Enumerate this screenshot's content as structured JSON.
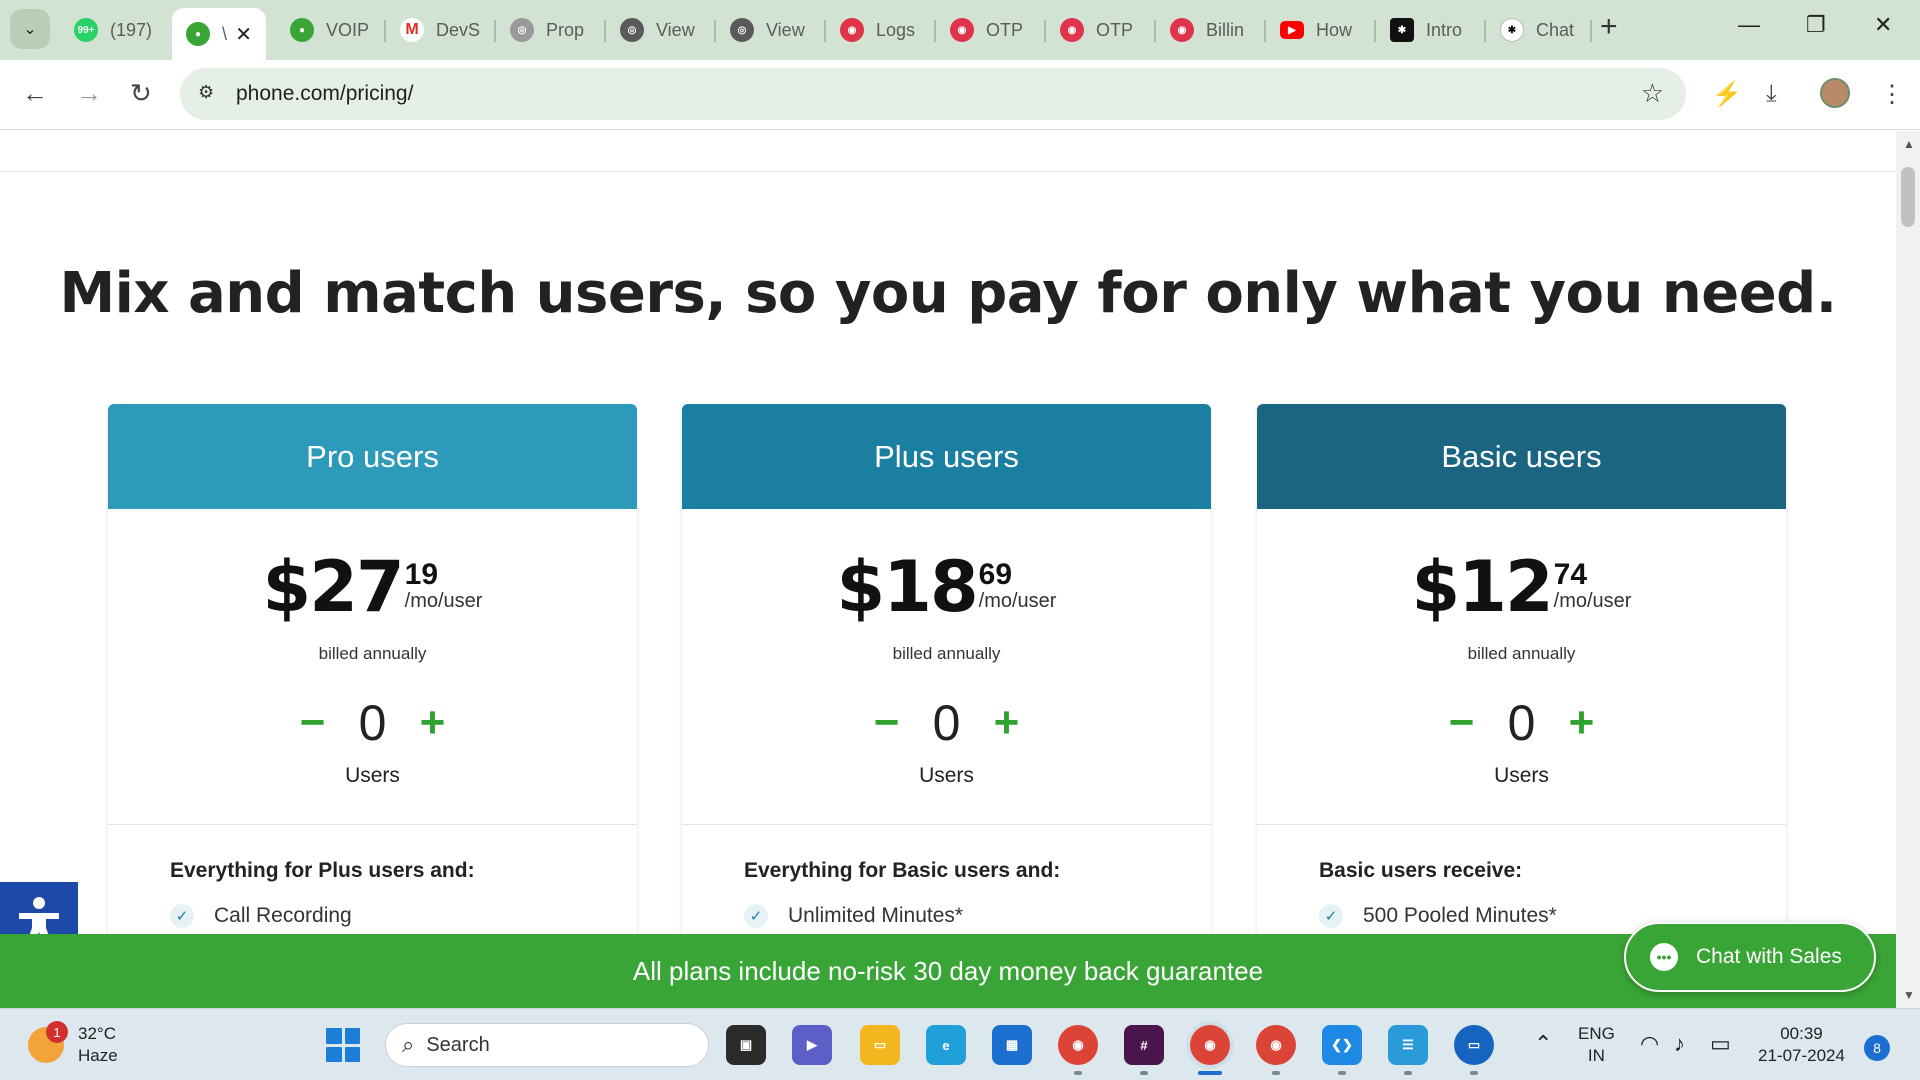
{
  "browser": {
    "tabs": [
      {
        "label": "(197)",
        "icon": "whatsapp-icon",
        "color": "#25d366"
      },
      {
        "label": "\\",
        "icon": "phone-pin-icon",
        "color": "#3aa537",
        "active": true
      },
      {
        "label": "VOIP",
        "icon": "phone-pin-icon",
        "color": "#3aa537"
      },
      {
        "label": "DevS",
        "icon": "gmail-icon",
        "color": "#d93025"
      },
      {
        "label": "Prop",
        "icon": "globe-icon",
        "color": "#6b6b6b"
      },
      {
        "label": "View",
        "icon": "globe-icon",
        "color": "#4a4a4a"
      },
      {
        "label": "View",
        "icon": "globe-icon",
        "color": "#4a4a4a"
      },
      {
        "label": "Logs",
        "icon": "target-icon",
        "color": "#e0344b"
      },
      {
        "label": "OTP",
        "icon": "target-icon",
        "color": "#e0344b"
      },
      {
        "label": "OTP",
        "icon": "target-icon",
        "color": "#e0344b"
      },
      {
        "label": "Billin",
        "icon": "target-icon",
        "color": "#e0344b"
      },
      {
        "label": "How",
        "icon": "youtube-icon",
        "color": "#ff0000"
      },
      {
        "label": "Intro",
        "icon": "chatgpt-icon",
        "color": "#111111"
      },
      {
        "label": "Chat",
        "icon": "chatgpt-icon",
        "color": "#111111"
      }
    ],
    "url": "phone.com/pricing/"
  },
  "page": {
    "headline": "Mix and match users, so you pay for only what you need.",
    "plans": [
      {
        "name": "Pro users",
        "head_color": "#2e9ab9",
        "price_whole": "$27",
        "price_cents": "19",
        "unit": "/mo/user",
        "billed": "billed annually",
        "count": "0",
        "count_label": "Users",
        "features_title": "Everything for Plus users and:",
        "first_feature": "Call Recording"
      },
      {
        "name": "Plus users",
        "head_color": "#1a7fa1",
        "price_whole": "$18",
        "price_cents": "69",
        "unit": "/mo/user",
        "billed": "billed annually",
        "count": "0",
        "count_label": "Users",
        "features_title": "Everything for Basic users and:",
        "first_feature": "Unlimited Minutes*"
      },
      {
        "name": "Basic users",
        "head_color": "#1b6482",
        "price_whole": "$12",
        "price_cents": "74",
        "unit": "/mo/user",
        "billed": "billed annually",
        "count": "0",
        "count_label": "Users",
        "features_title": "Basic users receive:",
        "first_feature": "500 Pooled Minutes*"
      }
    ],
    "minus_symbol": "−",
    "plus_symbol": "+",
    "guarantee": "All plans include no-risk 30 day money back guarantee",
    "chat_button": "Chat with Sales"
  },
  "taskbar": {
    "weather_temp": "32°C",
    "weather_desc": "Haze",
    "weather_badge": "1",
    "search_placeholder": "Search",
    "lang_line1": "ENG",
    "lang_line2": "IN",
    "time": "00:39",
    "date": "21-07-2024",
    "notifications": "8"
  }
}
